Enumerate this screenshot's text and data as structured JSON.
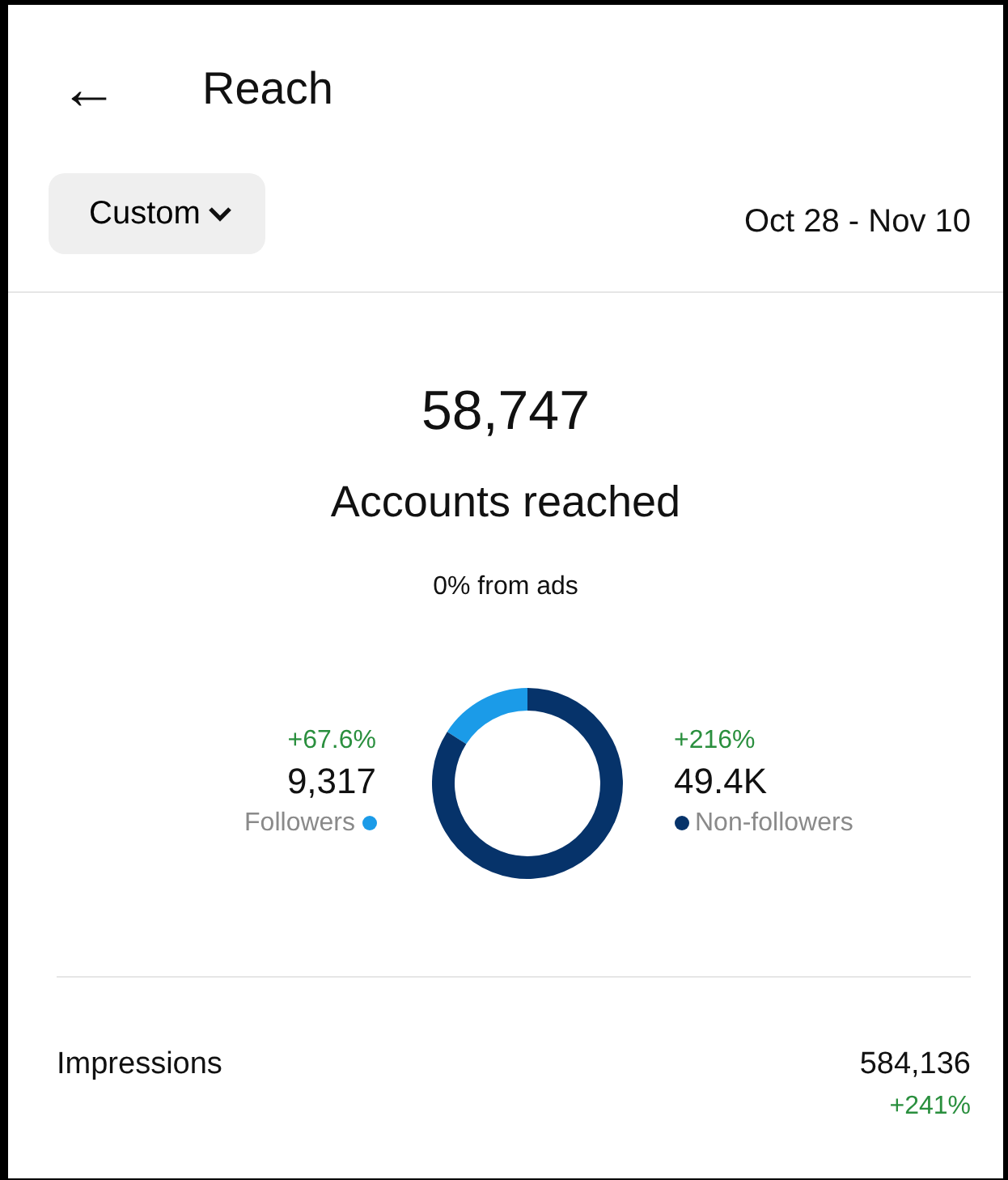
{
  "header": {
    "back": "←",
    "title": "Reach"
  },
  "filter": {
    "label": "Custom",
    "date_range": "Oct 28 - Nov 10"
  },
  "summary": {
    "value": "58,747",
    "note": "0% from ads"
  },
  "audience": [
    {
      "change": "+67.6%",
      "value": "9,317",
      "color": "#1b9be8"
    },
    {
      "change": "+216%",
      "value": "49.4K",
      "color": "#06336a"
    }
  ],
  "chart_data": {
    "type": "donut",
    "categories": [
      "Followers",
      "Non-followers"
    ],
    "series": [
      {
        "name": "Accounts reached",
        "values": [
          15.9,
          84.1
        ]
      }
    ]
  },
  "metrics": [
    {
      "label": "Impressions",
      "value": "584,136",
      "change": "+241%"
    }
  ]
}
